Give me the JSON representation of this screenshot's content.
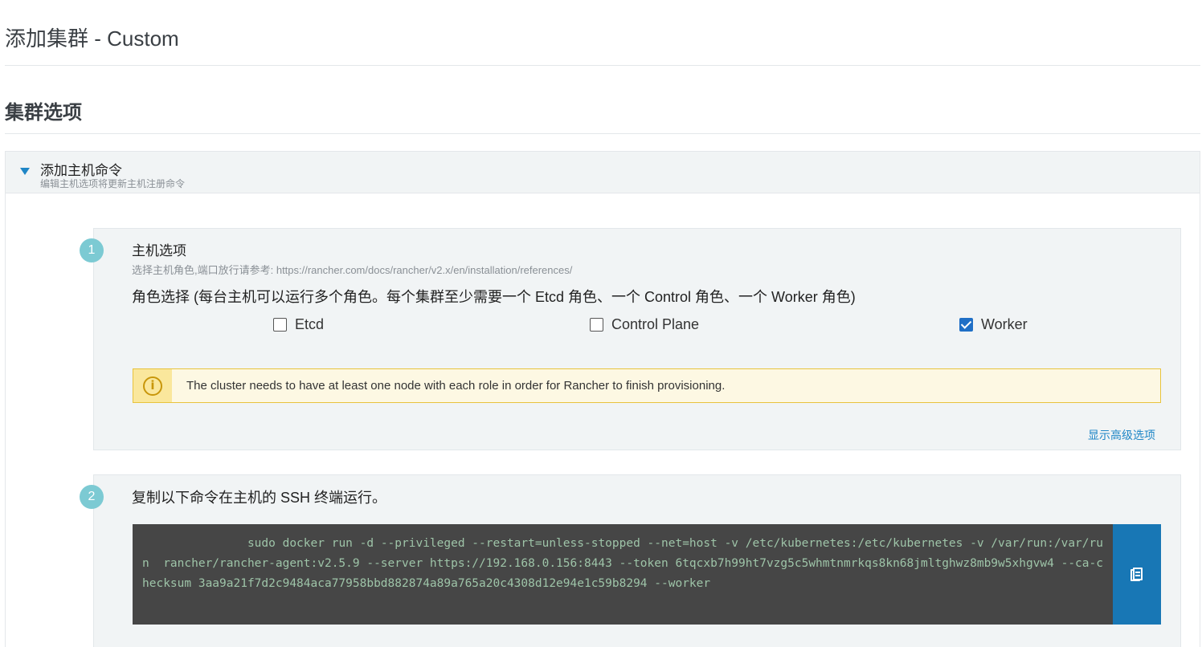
{
  "page": {
    "title": "添加集群 - Custom",
    "section_title": "集群选项"
  },
  "accordion": {
    "title": "添加主机命令",
    "subtitle": "编辑主机选项将更新主机注册命令"
  },
  "step1": {
    "number": "1",
    "title": "主机选项",
    "help": "选择主机角色,端口放行请参考: https://rancher.com/docs/rancher/v2.x/en/installation/references/",
    "role_label": "角色选择 (每台主机可以运行多个角色。每个集群至少需要一个 Etcd 角色、一个 Control 角色、一个 Worker 角色)",
    "roles": [
      {
        "label": "Etcd",
        "checked": false
      },
      {
        "label": "Control Plane",
        "checked": false
      },
      {
        "label": "Worker",
        "checked": true
      }
    ],
    "alert": {
      "icon": "info-icon",
      "text": "The cluster needs to have at least one node with each role in order for Rancher to finish provisioning."
    },
    "advanced_link": "显示高级选项"
  },
  "step2": {
    "number": "2",
    "title": "复制以下命令在主机的 SSH 终端运行。",
    "command": "               sudo docker run -d --privileged --restart=unless-stopped --net=host -v /etc/kubernetes:/etc/kubernetes -v /var/run:/var/run  rancher/rancher-agent:v2.5.9 --server https://192.168.0.156:8443 --token 6tqcxb7h99ht7vzg5c5whmtnmrkqs8kn68jmltghwz8mb9w5xhgvw4 --ca-checksum 3aa9a21f7d2c9484aca77958bbd882874a89a765a20c4308d12e94e1c59b8294 --worker",
    "copy_icon": "clipboard-icon"
  },
  "colors": {
    "accent": "#1f86c6",
    "copy_button": "#1877b5",
    "step_badge": "#7ccad3",
    "alert_border": "#e8c33d",
    "checkbox_checked": "#1f6fc6"
  }
}
